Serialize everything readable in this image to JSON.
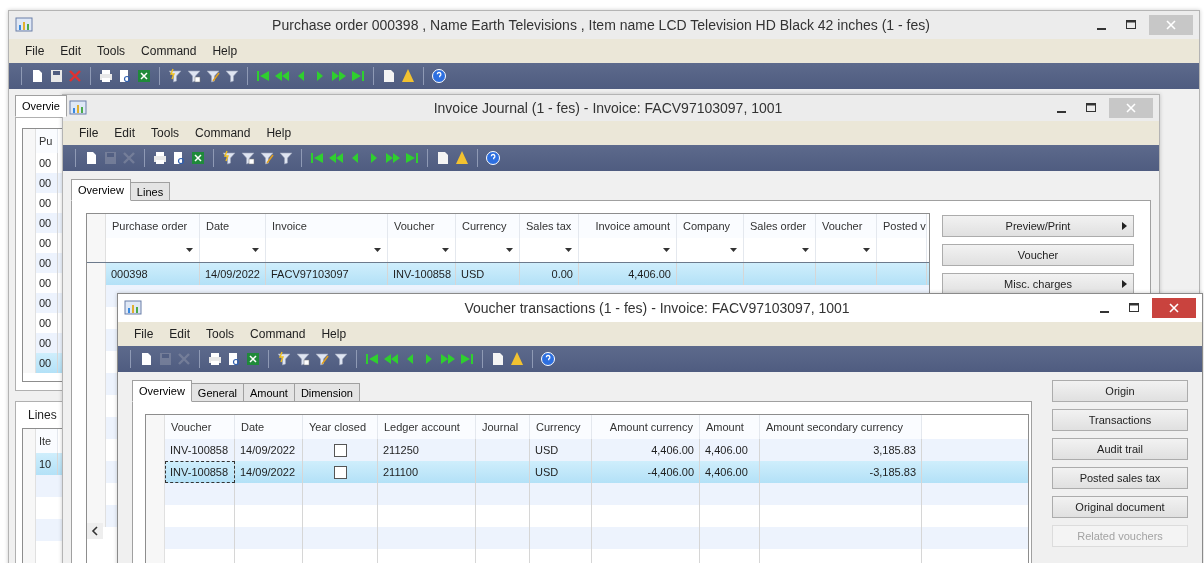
{
  "main_window": {
    "title": "Purchase order 000398 , Name Earth Televisions , Item name LCD Television HD Black 42 inches (1 - fes)",
    "active": false,
    "menu": [
      "File",
      "Edit",
      "Tools",
      "Command",
      "Help"
    ],
    "toolbar": [
      {
        "kind": "new",
        "disabled": false
      },
      {
        "kind": "save",
        "disabled": false
      },
      {
        "kind": "delete",
        "disabled": false
      },
      {
        "kind": "print",
        "disabled": false
      },
      {
        "kind": "preview",
        "disabled": false
      },
      {
        "kind": "excel",
        "disabled": false
      },
      {
        "kind": "filter-selection",
        "disabled": false
      },
      {
        "kind": "filter-grid",
        "disabled": false
      },
      {
        "kind": "filter-advanced",
        "disabled": false
      },
      {
        "kind": "filter",
        "disabled": false
      },
      {
        "kind": "first",
        "disabled": false
      },
      {
        "kind": "prev-page",
        "disabled": false
      },
      {
        "kind": "prev",
        "disabled": false
      },
      {
        "kind": "next",
        "disabled": false
      },
      {
        "kind": "next-page",
        "disabled": false
      },
      {
        "kind": "last",
        "disabled": false
      },
      {
        "kind": "document",
        "disabled": false
      },
      {
        "kind": "alert",
        "disabled": false
      },
      {
        "kind": "help",
        "disabled": false
      }
    ],
    "tabs": [
      {
        "label": "Overvie",
        "selected": true
      }
    ],
    "grid": {
      "columns": [
        "Pu"
      ],
      "rows": [
        {
          "cell": "00",
          "selected": false
        },
        {
          "cell": "00",
          "selected": false
        },
        {
          "cell": "00",
          "selected": false
        },
        {
          "cell": "00",
          "selected": false
        },
        {
          "cell": "00",
          "selected": false
        },
        {
          "cell": "00",
          "selected": false
        },
        {
          "cell": "00",
          "selected": false
        },
        {
          "cell": "00",
          "selected": false
        },
        {
          "cell": "00",
          "selected": false
        },
        {
          "cell": "00",
          "selected": false
        },
        {
          "cell": "00",
          "selected": true
        }
      ]
    },
    "lines": {
      "title": "Lines",
      "columns": [
        "Ite"
      ],
      "rows": [
        {
          "cell": "10",
          "selected": true
        }
      ]
    }
  },
  "invoice_journal": {
    "title": "Invoice Journal (1 - fes) - Invoice: FACV97103097, 1001",
    "active": false,
    "menu": [
      "File",
      "Edit",
      "Tools",
      "Command",
      "Help"
    ],
    "toolbar": [
      {
        "kind": "new",
        "disabled": false
      },
      {
        "kind": "save",
        "disabled": true
      },
      {
        "kind": "delete",
        "disabled": true
      },
      {
        "kind": "print",
        "disabled": false
      },
      {
        "kind": "preview",
        "disabled": false
      },
      {
        "kind": "excel",
        "disabled": false
      },
      {
        "kind": "filter-selection",
        "disabled": false
      },
      {
        "kind": "filter-grid",
        "disabled": false
      },
      {
        "kind": "filter-advanced",
        "disabled": false
      },
      {
        "kind": "filter",
        "disabled": false
      },
      {
        "kind": "first",
        "disabled": false
      },
      {
        "kind": "prev-page",
        "disabled": false
      },
      {
        "kind": "prev",
        "disabled": false
      },
      {
        "kind": "next",
        "disabled": false
      },
      {
        "kind": "next-page",
        "disabled": false
      },
      {
        "kind": "last",
        "disabled": false
      },
      {
        "kind": "document",
        "disabled": false
      },
      {
        "kind": "alert",
        "disabled": false
      },
      {
        "kind": "help",
        "disabled": false
      }
    ],
    "tabs": [
      {
        "label": "Overview",
        "selected": true
      },
      {
        "label": "Lines",
        "selected": false
      }
    ],
    "grid": {
      "columns": [
        "Purchase order",
        "Date",
        "Invoice",
        "Voucher",
        "Currency",
        "Sales tax",
        "Invoice amount",
        "Company",
        "Sales order",
        "Voucher",
        "Posted v"
      ],
      "rows": [
        {
          "purchase_order": "000398",
          "date": "14/09/2022",
          "invoice": "FACV97103097",
          "voucher": "INV-100858",
          "currency": "USD",
          "sales_tax": "0.00",
          "invoice_amount": "4,406.00",
          "selected": true
        }
      ]
    },
    "buttons": [
      {
        "label": "Preview/Print",
        "submenu": true
      },
      {
        "label": "Voucher",
        "submenu": false
      },
      {
        "label": "Misc. charges",
        "submenu": true
      }
    ]
  },
  "voucher_transactions": {
    "title": "Voucher transactions (1 - fes) - Invoice: FACV97103097, 1001",
    "active": true,
    "menu": [
      "File",
      "Edit",
      "Tools",
      "Command",
      "Help"
    ],
    "toolbar": [
      {
        "kind": "new",
        "disabled": false
      },
      {
        "kind": "save",
        "disabled": true
      },
      {
        "kind": "delete",
        "disabled": true
      },
      {
        "kind": "print",
        "disabled": false
      },
      {
        "kind": "preview",
        "disabled": false
      },
      {
        "kind": "excel",
        "disabled": false
      },
      {
        "kind": "filter-selection",
        "disabled": false
      },
      {
        "kind": "filter-grid",
        "disabled": false
      },
      {
        "kind": "filter-advanced",
        "disabled": false
      },
      {
        "kind": "filter",
        "disabled": false
      },
      {
        "kind": "first",
        "disabled": false
      },
      {
        "kind": "prev-page",
        "disabled": false
      },
      {
        "kind": "prev",
        "disabled": false
      },
      {
        "kind": "next",
        "disabled": false
      },
      {
        "kind": "next-page",
        "disabled": false
      },
      {
        "kind": "last",
        "disabled": false
      },
      {
        "kind": "document",
        "disabled": false
      },
      {
        "kind": "alert",
        "disabled": false
      },
      {
        "kind": "help",
        "disabled": false
      }
    ],
    "tabs": [
      {
        "label": "Overview",
        "selected": true
      },
      {
        "label": "General",
        "selected": false
      },
      {
        "label": "Amount",
        "selected": false
      },
      {
        "label": "Dimension",
        "selected": false
      }
    ],
    "grid": {
      "columns": [
        "Voucher",
        "Date",
        "Year closed",
        "Ledger account",
        "Journal",
        "Currency",
        "Amount currency",
        "Amount",
        "Amount secondary currency"
      ],
      "rows": [
        {
          "voucher": "INV-100858",
          "date": "14/09/2022",
          "year_closed": false,
          "ledger_account": "211250",
          "currency": "USD",
          "amount_currency": "4,406.00",
          "amount": "4,406.00",
          "amount_secondary_currency": "3,185.83",
          "selected": false,
          "focused": false
        },
        {
          "voucher": "INV-100858",
          "date": "14/09/2022",
          "year_closed": false,
          "ledger_account": "211100",
          "currency": "USD",
          "amount_currency": "-4,406.00",
          "amount": "4,406.00",
          "amount_secondary_currency": "-3,185.83",
          "selected": true,
          "focused": true
        }
      ]
    },
    "buttons": [
      {
        "label": "Origin",
        "disabled": false
      },
      {
        "label": "Transactions",
        "disabled": false
      },
      {
        "label": "Audit trail",
        "disabled": false
      },
      {
        "label": "Posted sales tax",
        "disabled": false
      },
      {
        "label": "Original document",
        "disabled": false
      },
      {
        "label": "Related vouchers",
        "disabled": true
      }
    ]
  }
}
